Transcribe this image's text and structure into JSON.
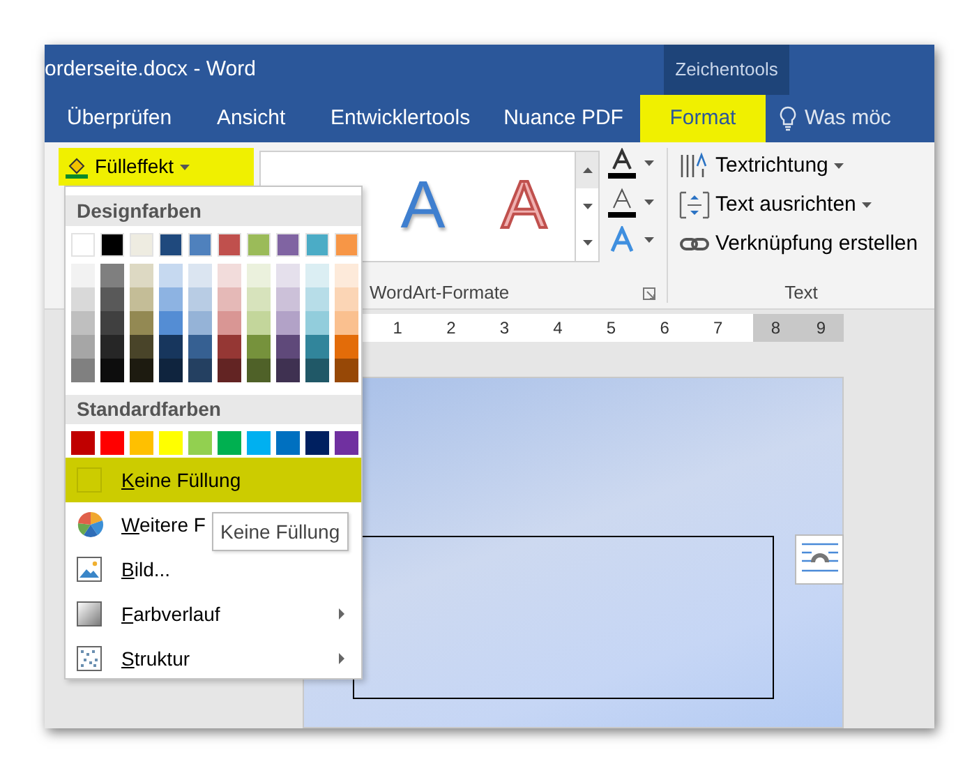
{
  "window": {
    "title": "orderseite.docx - Word",
    "context_label": "Zeichentools"
  },
  "tabs": [
    {
      "label": "Überprüfen",
      "selected": false
    },
    {
      "label": "Ansicht",
      "selected": false
    },
    {
      "label": "Entwicklertools",
      "selected": false
    },
    {
      "label": "Nuance PDF",
      "selected": false
    },
    {
      "label": "Format",
      "selected": true
    }
  ],
  "tell_me": "Was möc",
  "ribbon": {
    "fill_button": {
      "label": "Fülleffekt",
      "highlighted": true
    },
    "wordart_group": {
      "label": "WordArt-Formate",
      "styles": [
        {
          "letter": "A",
          "kind": "shadow"
        },
        {
          "letter": "A",
          "kind": "outline"
        }
      ]
    },
    "text_group": {
      "label": "Text",
      "commands": [
        {
          "label": "Textrichtung",
          "kind": "direction",
          "dropdown": true
        },
        {
          "label": "Text ausrichten",
          "kind": "align",
          "dropdown": true
        },
        {
          "label": "Verknüpfung erstellen",
          "kind": "link",
          "dropdown": false
        }
      ]
    }
  },
  "ruler": {
    "numbers": [
      "1",
      "2",
      "3",
      "4",
      "5",
      "6",
      "7",
      "8",
      "9"
    ]
  },
  "fill_menu": {
    "theme_title": "Designfarben",
    "theme_colors": [
      {
        "color": "#ffffff",
        "shades": [
          {
            "color": "#f2f2f2"
          },
          {
            "color": "#d9d9d9"
          },
          {
            "color": "#bfbfbf"
          },
          {
            "color": "#a6a6a6"
          },
          {
            "color": "#808080"
          }
        ]
      },
      {
        "color": "#000000",
        "shades": [
          {
            "color": "#7f7f7f"
          },
          {
            "color": "#595959"
          },
          {
            "color": "#404040"
          },
          {
            "color": "#262626"
          },
          {
            "color": "#0d0d0d"
          }
        ]
      },
      {
        "color": "#eeece1",
        "shades": [
          {
            "color": "#ddd9c3"
          },
          {
            "color": "#c4bd97"
          },
          {
            "color": "#938953"
          },
          {
            "color": "#494429"
          },
          {
            "color": "#1d1b10"
          }
        ]
      },
      {
        "color": "#1f497d",
        "shades": [
          {
            "color": "#c6d9f0"
          },
          {
            "color": "#8db3e2"
          },
          {
            "color": "#548dd4"
          },
          {
            "color": "#17365d"
          },
          {
            "color": "#0f243e"
          }
        ]
      },
      {
        "color": "#4f81bd",
        "shades": [
          {
            "color": "#dbe5f1"
          },
          {
            "color": "#b8cce4"
          },
          {
            "color": "#95b3d7"
          },
          {
            "color": "#366092"
          },
          {
            "color": "#244061"
          }
        ]
      },
      {
        "color": "#c0504d",
        "shades": [
          {
            "color": "#f2dcdb"
          },
          {
            "color": "#e5b9b7"
          },
          {
            "color": "#d99694"
          },
          {
            "color": "#953734"
          },
          {
            "color": "#632423"
          }
        ]
      },
      {
        "color": "#9bbb59",
        "shades": [
          {
            "color": "#ebf1dd"
          },
          {
            "color": "#d7e3bc"
          },
          {
            "color": "#c3d69b"
          },
          {
            "color": "#76923c"
          },
          {
            "color": "#4f6128"
          }
        ]
      },
      {
        "color": "#8064a2",
        "shades": [
          {
            "color": "#e5e0ec"
          },
          {
            "color": "#ccc1d9"
          },
          {
            "color": "#b2a2c7"
          },
          {
            "color": "#5f497a"
          },
          {
            "color": "#3f3151"
          }
        ]
      },
      {
        "color": "#4bacc6",
        "shades": [
          {
            "color": "#dbeef3"
          },
          {
            "color": "#b7dde8"
          },
          {
            "color": "#92cddc"
          },
          {
            "color": "#31859b"
          },
          {
            "color": "#205867"
          }
        ]
      },
      {
        "color": "#f79646",
        "shades": [
          {
            "color": "#fdeada"
          },
          {
            "color": "#fbd5b5"
          },
          {
            "color": "#fac08f"
          },
          {
            "color": "#e36c09"
          },
          {
            "color": "#974806"
          }
        ]
      }
    ],
    "standard_title": "Standardfarben",
    "standard_colors": [
      {
        "color": "#c00000"
      },
      {
        "color": "#ff0000"
      },
      {
        "color": "#ffc000"
      },
      {
        "color": "#ffff00"
      },
      {
        "color": "#92d050"
      },
      {
        "color": "#00b050"
      },
      {
        "color": "#00b0f0"
      },
      {
        "color": "#0070c0"
      },
      {
        "color": "#002060"
      },
      {
        "color": "#7030a0"
      }
    ],
    "items": [
      {
        "label": "Keine Füllung",
        "kind": "no-fill",
        "highlighted": true,
        "submenu": false
      },
      {
        "label": "Weitere F",
        "kind": "more-colors",
        "highlighted": false,
        "submenu": false
      },
      {
        "label": "Bild...",
        "kind": "picture",
        "highlighted": false,
        "submenu": false
      },
      {
        "label": "Farbverlauf",
        "kind": "gradient",
        "highlighted": false,
        "submenu": true
      },
      {
        "label": "Struktur",
        "kind": "texture",
        "highlighted": false,
        "submenu": true
      }
    ]
  },
  "tooltip": "Keine Füllung"
}
